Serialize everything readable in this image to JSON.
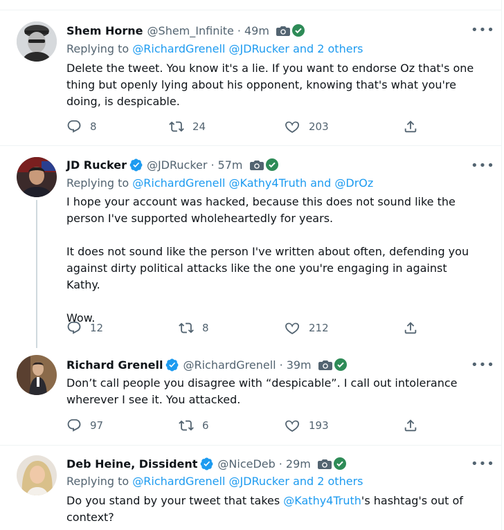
{
  "tweets": [
    {
      "name": "Shem Horne",
      "verified": false,
      "handle": "@Shem_Infinite",
      "time": "49m",
      "replying_prefix": "Replying to",
      "replying_to": "@RichardGrenell @JDRucker and 2 others",
      "text": [
        "Delete the tweet. You know it's a lie. If you want to endorse Oz that's one thing but openly lying about his opponent, knowing that's what you're doing, is despicable."
      ],
      "replies": "8",
      "retweets": "24",
      "likes": "203"
    },
    {
      "name": "JD Rucker",
      "verified": true,
      "handle": "@JDRucker",
      "time": "57m",
      "replying_prefix": "Replying to",
      "replying_to": "@RichardGrenell @Kathy4Truth and @DrOz",
      "text": [
        "I hope your account was hacked, because this does not sound like the person I've supported wholeheartedly for years.",
        "It does not sound like the person I've written about often, defending you against dirty political attacks like the one you're engaging in against Kathy.",
        "Wow."
      ],
      "replies": "12",
      "retweets": "8",
      "likes": "212"
    },
    {
      "name": "Richard Grenell",
      "verified": true,
      "handle": "@RichardGrenell",
      "time": "39m",
      "text": [
        "Don’t call people you disagree with “despicable”. I call out intolerance wherever I see it. You attacked."
      ],
      "replies": "97",
      "retweets": "6",
      "likes": "193"
    },
    {
      "name": "Deb Heine, Dissident",
      "verified": true,
      "handle": "@NiceDeb",
      "time": "29m",
      "replying_prefix": "Replying to",
      "replying_to": "@RichardGrenell @JDRucker and 2 others",
      "text_before": "Do you stand by your tweet that takes ",
      "text_mention": "@Kathy4Truth",
      "text_after": "'s hashtag's out of context?"
    }
  ],
  "ui": {
    "separator": "·",
    "more": "•••"
  },
  "colors": {
    "accent": "#1d9bf0",
    "secondary": "#536471",
    "verified_green": "#2e8b57",
    "border": "#eff3f4"
  },
  "icons": [
    "reply-icon",
    "retweet-icon",
    "like-icon",
    "share-icon",
    "camera-icon",
    "verified-icon",
    "green-check-icon",
    "more-icon"
  ]
}
